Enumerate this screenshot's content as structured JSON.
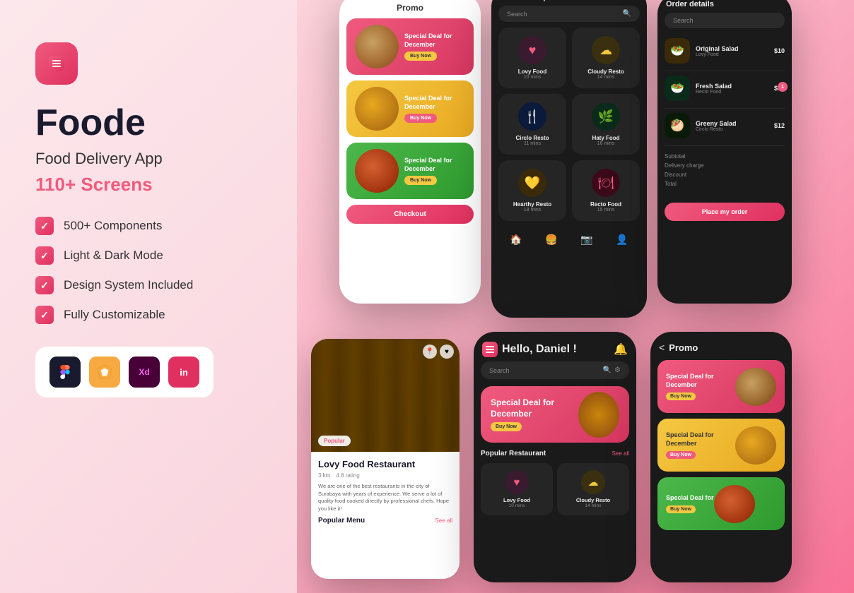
{
  "app": {
    "name": "Foode",
    "tagline": "Food Delivery App",
    "screens_count": "110+ Screens",
    "icon_label": "menu-icon"
  },
  "features": [
    {
      "label": "500+ Components"
    },
    {
      "label": "Light & Dark Mode"
    },
    {
      "label": "Design System Included"
    },
    {
      "label": "Fully Customizable"
    }
  ],
  "tools": [
    {
      "name": "Figma",
      "abbr": "F"
    },
    {
      "name": "Sketch",
      "abbr": "S"
    },
    {
      "name": "Adobe XD",
      "abbr": "Xd"
    },
    {
      "name": "InVision",
      "abbr": "in"
    }
  ],
  "phone1": {
    "title": "Promo",
    "promo_cards": [
      {
        "label": "Special Deal for December",
        "color": "red",
        "btn": "Buy Now"
      },
      {
        "label": "Special Deal for December",
        "color": "yellow",
        "btn": "Buy Now"
      },
      {
        "label": "Special Deal for December",
        "color": "green",
        "btn": "Buy Now"
      }
    ],
    "checkout_btn": "Checkout"
  },
  "phone2": {
    "title": "Popular Restaurant",
    "search_placeholder": "Search",
    "restaurants": [
      {
        "name": "Lovy Food",
        "time": "10 mins",
        "icon": "❤️",
        "icon_color": "pink"
      },
      {
        "name": "Cloudy Resto",
        "time": "14 mins",
        "icon": "☁️",
        "icon_color": "yellow"
      },
      {
        "name": "Circlo Resto",
        "time": "11 mins",
        "icon": "🍴",
        "icon_color": "blue"
      },
      {
        "name": "Haty Food",
        "time": "16 mins",
        "icon": "🌿",
        "icon_color": "green"
      },
      {
        "name": "Hearthy Resto",
        "time": "18 mins",
        "icon": "💛",
        "icon_color": "yellow2"
      },
      {
        "name": "Recto Food",
        "time": "15 mins",
        "icon": "🍽️",
        "icon_color": "red"
      }
    ],
    "nav": [
      "🏠",
      "🍔",
      "📷",
      "👤"
    ]
  },
  "phone3": {
    "title": "Order details",
    "search_placeholder": "Search",
    "items": [
      {
        "name": "Original Salad",
        "restaurant": "Lovy Food",
        "price": "$10",
        "icon": "🥗"
      },
      {
        "name": "Fresh Salad",
        "restaurant": "Recto Food",
        "price": "$10",
        "icon": "🥗",
        "qty": 1
      },
      {
        "name": "Greeny Salad",
        "restaurant": "Circlo Resto",
        "price": "$12",
        "icon": "🥙"
      }
    ],
    "summary": {
      "subtotal_label": "Subtotal",
      "delivery_label": "Delivery charge",
      "discount_label": "Discount",
      "total_label": "Total"
    },
    "place_order_btn": "Place my order"
  },
  "phone4": {
    "badge": "Popular",
    "restaurant_name": "Lovy Food Restaurant",
    "distance": "3 km",
    "rating": "4.8 rating",
    "description": "We are one of the best restaurants in the city of Surabaya with years of experience. We serve a lot of quality food cooked directly by professional chefs. Hope you like it!",
    "popular_menu_label": "Popular Menu",
    "see_all_label": "See all"
  },
  "phone5": {
    "greeting": "Hello, Daniel !",
    "search_placeholder": "Search",
    "promo_label": "Special Deal for December",
    "promo_btn": "Buy Now",
    "popular_label": "Popular Restaurant",
    "see_all_label": "See all",
    "restaurants": [
      {
        "name": "Lovy Food",
        "time": "10 mins",
        "icon": "❤️",
        "icon_color": "pink"
      },
      {
        "name": "Cloudy Resto",
        "time": "14 mins",
        "icon": "☁️",
        "icon_color": "yellow"
      }
    ]
  },
  "phone6": {
    "title": "Promo",
    "back_label": "<",
    "promo_cards": [
      {
        "label": "Special Deal for December",
        "color": "red",
        "btn": "Buy Now"
      },
      {
        "label": "Special Deal for December",
        "color": "yellow",
        "btn": "Buy Now"
      },
      {
        "label": "Special Deal for",
        "color": "green",
        "btn": "Buy Now"
      }
    ]
  },
  "colors": {
    "accent": "#f05a7e",
    "yellow_accent": "#f5c842",
    "green_accent": "#4cb84c",
    "dark_bg": "#1a1a1a",
    "dark_card": "#252525"
  }
}
